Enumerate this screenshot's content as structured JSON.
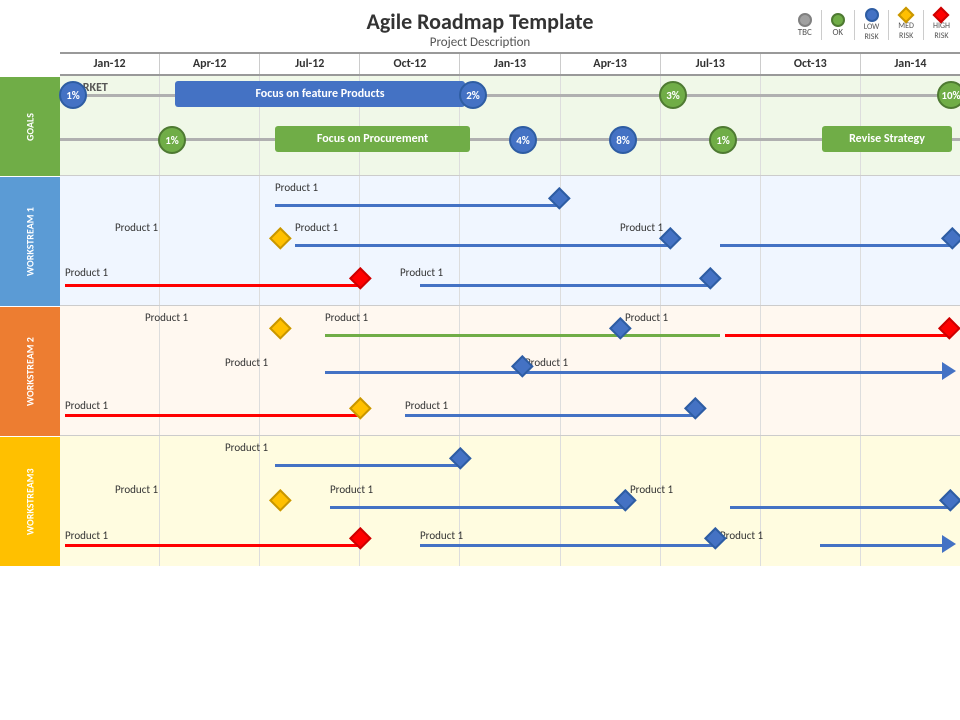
{
  "header": {
    "title": "Agile Roadmap Template",
    "subtitle": "Project Description"
  },
  "legend": {
    "items": [
      {
        "label": "TBC",
        "color": "#808080",
        "type": "dot"
      },
      {
        "label": "OK",
        "color": "#70ad47",
        "type": "dot"
      },
      {
        "label": "LOW\nRISK",
        "color": "#4472c4",
        "type": "dot"
      },
      {
        "label": "MED\nRISK",
        "color": "#ffc000",
        "type": "diamond"
      },
      {
        "label": "HIGH\nRISK",
        "color": "#ff0000",
        "type": "diamond"
      }
    ]
  },
  "timeline": {
    "columns": [
      "Jan-12",
      "Apr-12",
      "Jul-12",
      "Oct-12",
      "Jan-13",
      "Apr-13",
      "Jul-13",
      "Oct-13",
      "Jan-14"
    ]
  },
  "sections": {
    "goals_label": "GOALS",
    "ws1_label": "WORKSTREAM 1",
    "ws2_label": "WORKSTREAM 2",
    "ws3_label": "WORKSTREAM3"
  },
  "market_label": "MARKET",
  "goals": {
    "bar1_text": "Focus on feature Products",
    "bar2_text": "Focus on Procurement",
    "bar3_text": "Revise Strategy",
    "milestones": [
      "1%",
      "2%",
      "3%",
      "10%",
      "1%",
      "4%",
      "8%",
      "1%"
    ]
  },
  "products": {
    "label": "Product 1"
  }
}
